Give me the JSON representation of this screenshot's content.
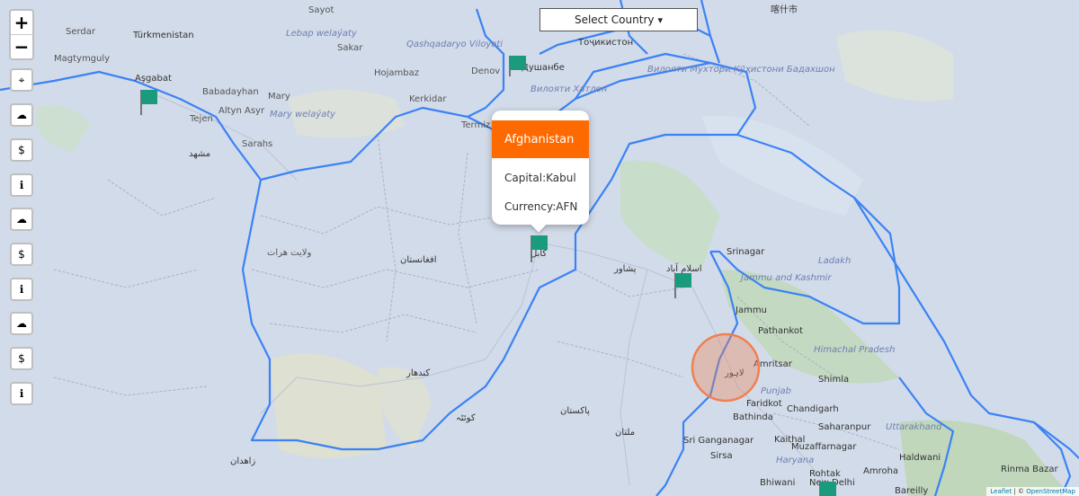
{
  "zoom": {
    "in_label": "+",
    "out_label": "−"
  },
  "select_country": {
    "label": "Select Country",
    "caret": "▾"
  },
  "popup": {
    "title": "Afghanistan",
    "capital": "Capital:Kabul",
    "currency": "Currency:AFN",
    "header_color": "#ff6a00"
  },
  "side_controls": [
    {
      "icon": "locate-icon",
      "glyph": "⌖"
    },
    {
      "icon": "cloud-icon",
      "glyph": "☁"
    },
    {
      "icon": "dollar-icon",
      "glyph": "$"
    },
    {
      "icon": "info-icon",
      "glyph": "ℹ"
    },
    {
      "icon": "cloud-icon",
      "glyph": "☁"
    },
    {
      "icon": "dollar-icon",
      "glyph": "$"
    },
    {
      "icon": "info-icon",
      "glyph": "ℹ"
    },
    {
      "icon": "cloud-icon",
      "glyph": "☁"
    },
    {
      "icon": "dollar-icon",
      "glyph": "$"
    },
    {
      "icon": "info-icon",
      "glyph": "ℹ"
    }
  ],
  "attribution": {
    "leaflet": "Leaflet",
    "sep": " | © ",
    "osm": "OpenStreetMap"
  },
  "colors": {
    "border": "#3b82f6",
    "flag": "#1a9b7d",
    "circle": "#f08050",
    "map_bg": "#cfd9ea"
  },
  "labels": {
    "serdar": "Serdar",
    "turkmenistan": "Türkmenistan",
    "magtymguly": "Magtymguly",
    "asgabat": "Aşgabat",
    "babadayhan": "Babadayhan",
    "altyn_asyr": "Altyn Asyr",
    "tejen": "Tejen",
    "saraks": "Sarahs",
    "mary": "Mary",
    "mary_welayaty": "Mary welaýaty",
    "lebap": "Lebap welaýaty",
    "hojambaz": "Hojambaz",
    "sayot": "Sayot",
    "sakar": "Sakar",
    "qashqadaryo": "Qashqadaryo Viloyati",
    "denov": "Denov",
    "dushanbe": "Душанбе",
    "tojikiston": "Тоҷикистон",
    "khatlon": "Вилояти Хатлон",
    "gbao": "Вилояти Мухтори Кӯҳистони Бадахшон",
    "termiz": "Termiz",
    "kerkidar": "Kerkidar",
    "kashgar": "喀什市",
    "srinagar": "Srinagar",
    "jammu": "Jammu",
    "amritsar": "Amritsar",
    "pathankot": "Pathankot",
    "chandigarh": "Chandigarh",
    "shimla": "Shimla",
    "saharanpur": "Saharanpur",
    "muzaffarnagar": "Muzaffarnagar",
    "new_delhi": "New Delhi",
    "bareilly": "Bareilly",
    "bathinda": "Bathinda",
    "faridkot": "Faridkot",
    "ladakh": "Ladakh",
    "jk": "Jammu and Kashmir",
    "hp": "Himachal Pradesh",
    "punjab": "Punjab",
    "haryana": "Haryana",
    "sri_ganganagar": "Sri Ganganagar",
    "kaithal": "Kaithal",
    "rohtak": "Rohtak",
    "amroha": "Amroha",
    "bhiwani": "Bhiwani",
    "sirsa": "Sirsa",
    "haldwani": "Haldwani",
    "uttarakhand": "Uttarakhand",
    "rinma": "Rinma Bazar",
    "afghanistan_fa": "افغانستان",
    "kabul_fa": "کابل",
    "kandahar_fa": "کندهار",
    "herat_fa": "ولایت هرات",
    "islamabad_fa": "اسلام آباد",
    "lahore_fa": "لاہور",
    "pakistan_fa": "پاکستان",
    "quetta_fa": "کوئٹہ",
    "mashhad_fa": "مشهد",
    "zahedan_fa": "زاهدان",
    "multan_fa": "ملتان",
    "peshawar_fa": "پشاور"
  }
}
